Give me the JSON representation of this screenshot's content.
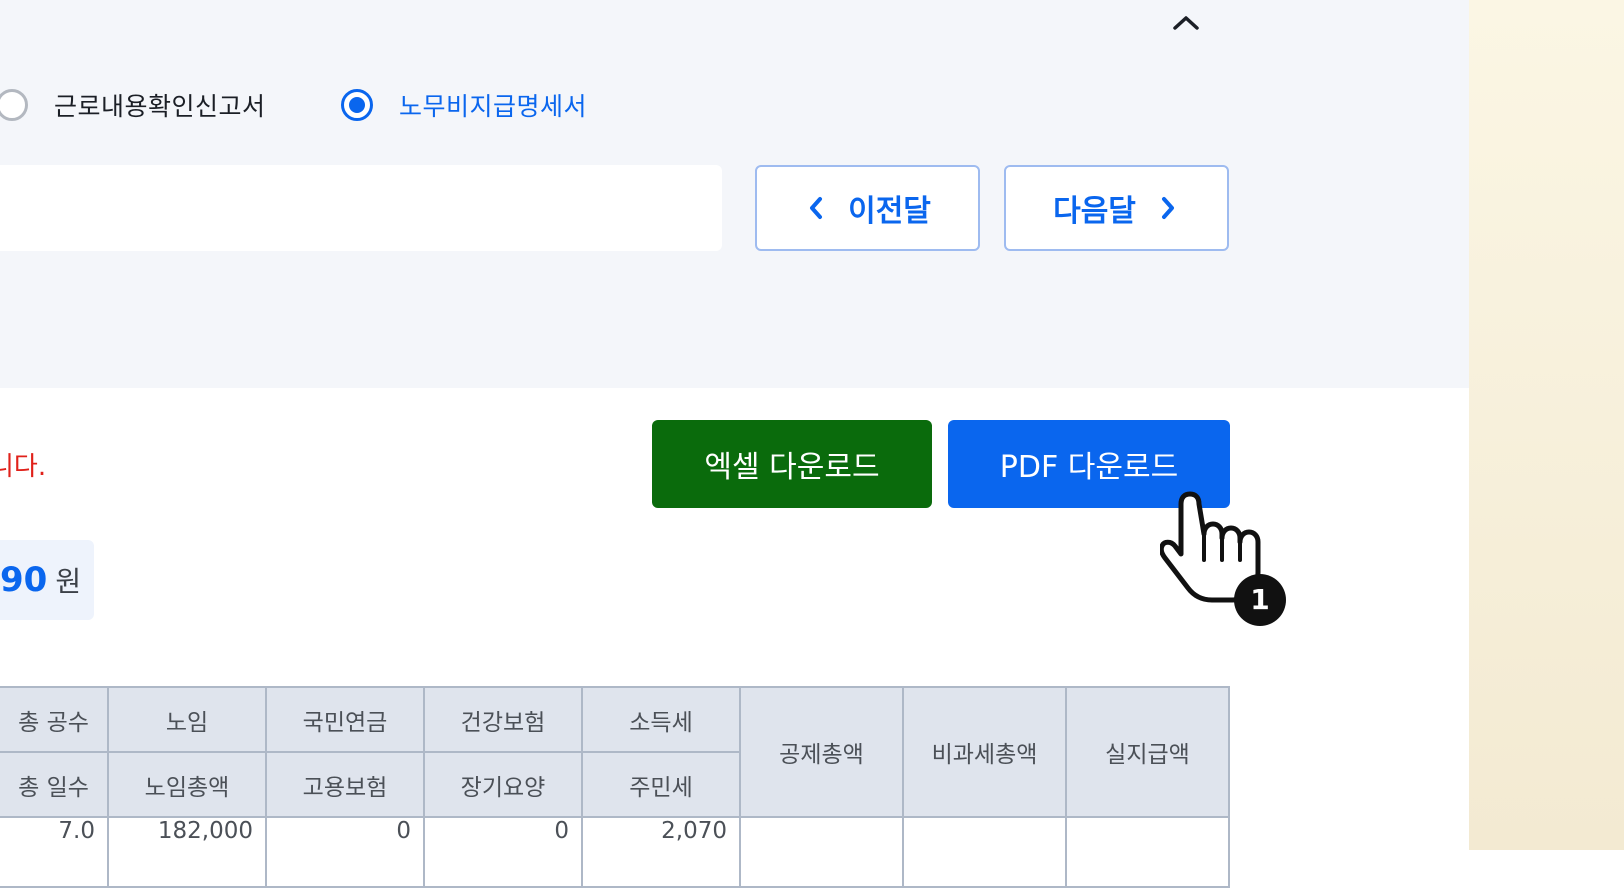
{
  "filter": {
    "radio_options": [
      {
        "label": "근로내용확인신고서",
        "selected": false
      },
      {
        "label": "노무비지급명세서",
        "selected": true
      }
    ],
    "month_input_value": "",
    "prev_month_label": "이전달",
    "next_month_label": "다음달"
  },
  "actions": {
    "notice_text": "니다.",
    "excel_download_label": "엑셀 다운로드",
    "pdf_download_label": "PDF 다운로드"
  },
  "summary": {
    "total_amount": "90",
    "total_unit": "원"
  },
  "table": {
    "headers_row1": [
      "총 공수",
      "노임",
      "국민연금",
      "건강보험",
      "소득세",
      "공제총액",
      "비과세총액",
      "실지급액"
    ],
    "headers_row2": [
      "총 일수",
      "노임총액",
      "고용보험",
      "장기요양",
      "주민세"
    ],
    "first_row_partial": [
      "7.0",
      "182,000",
      "0",
      "0",
      "2,070",
      "",
      "",
      ""
    ]
  },
  "cursor": {
    "step_badge": "1"
  },
  "colors": {
    "accent_blue": "#0a66ee",
    "excel_green": "#0a6b0c",
    "notice_red": "#e0211a",
    "panel_bg": "#f4f6fa"
  }
}
